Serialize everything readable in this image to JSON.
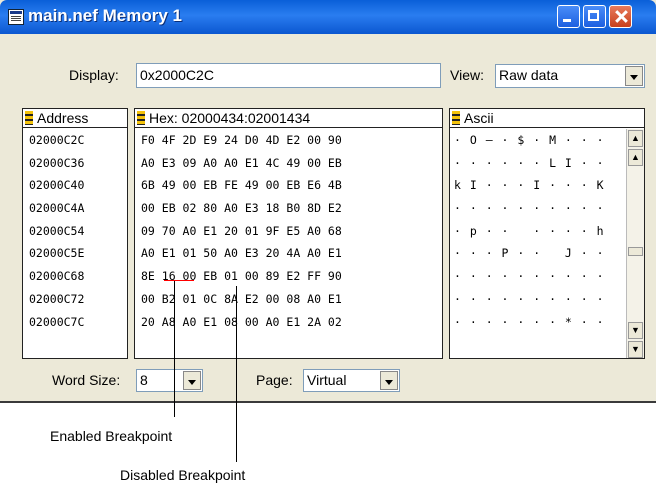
{
  "window": {
    "title": "main.nef Memory 1"
  },
  "display": {
    "label": "Display:",
    "value": "0x2000C2C"
  },
  "view": {
    "label": "View:",
    "value": "Raw data"
  },
  "address": {
    "header": "Address",
    "rows": [
      "02000C2C",
      "02000C36",
      "02000C40",
      "02000C4A",
      "02000C54",
      "02000C5E",
      "02000C68",
      "02000C72",
      "02000C7C"
    ]
  },
  "hex": {
    "header": "Hex: 02000434:02001434",
    "rows": [
      "F0 4F 2D E9 24 D0 4D E2 00 90",
      "A0 E3 09 A0 A0 E1 4C 49 00 EB",
      "6B 49 00 EB FE 49 00 EB E6 4B",
      "00 EB 02 80 A0 E3 18 B0 8D E2",
      "09 70 A0 E1 20 01 9F E5 A0 68",
      "A0 E1 01 50 A0 E3 20 4A A0 E1",
      "8E 16 00 EB 01 00 89 E2 FF 90",
      "00 B2 01 0C 8A E2 00 08 A0 E1",
      "20 A8 A0 E1 08 00 A0 E1 2A 02"
    ]
  },
  "ascii": {
    "header": "Ascii",
    "rows": [
      "· O – · $ · M · · ·",
      "· · · · · · L I · ·",
      "k I · · · I · · · K",
      "· · · · · · · · · ·",
      "· p · ·   · · · · h",
      "· · · P · ·   J · ·",
      "· · · · · · · · · ·",
      "· · · · · · · · · ·",
      "· · · · · · · * · ·"
    ]
  },
  "word_size": {
    "label": "Word Size:",
    "value": "8"
  },
  "page": {
    "label": "Page:",
    "value": "Virtual"
  },
  "captions": {
    "enabled": "Enabled Breakpoint",
    "disabled": "Disabled Breakpoint"
  },
  "colors": {
    "titlebar": "#0b57d0",
    "disabled_breakpoint": "#ff0000",
    "window_bg": "#ece9d8"
  }
}
